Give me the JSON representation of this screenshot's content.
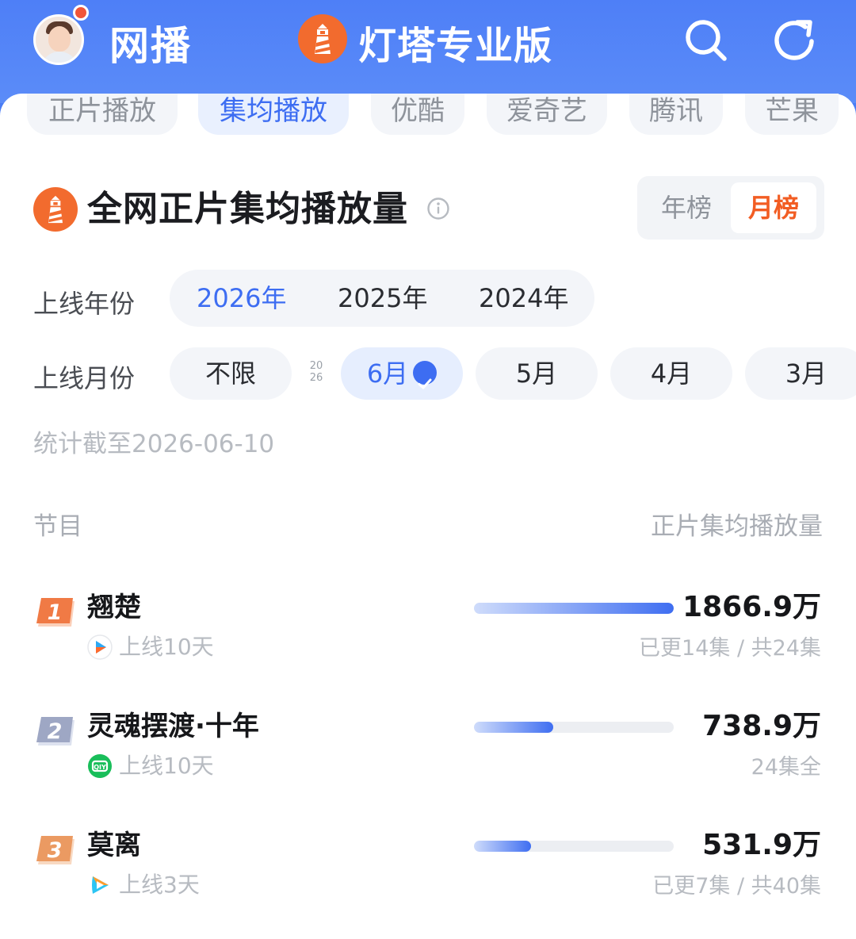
{
  "header": {
    "app_title": "网播",
    "brand_name": "灯塔专业版"
  },
  "tabs": [
    {
      "label": "正片播放",
      "active": false
    },
    {
      "label": "集均播放",
      "active": true
    },
    {
      "label": "优酷",
      "active": false
    },
    {
      "label": "爱奇艺",
      "active": false
    },
    {
      "label": "腾讯",
      "active": false
    },
    {
      "label": "芒果",
      "active": false
    }
  ],
  "section": {
    "title": "全网正片集均播放量",
    "toggle": {
      "year": "年榜",
      "month": "月榜",
      "selected": "月榜"
    }
  },
  "filters": {
    "year_label": "上线年份",
    "years": [
      "2026年",
      "2025年",
      "2024年"
    ],
    "selected_year": "2026年",
    "month_label": "上线月份",
    "months": [
      "不限",
      "6月",
      "5月",
      "4月",
      "3月"
    ],
    "selected_month": "6月",
    "year_marker": [
      "20",
      "26"
    ]
  },
  "as_of": "统计截至2026-06-10",
  "table": {
    "col_left": "节目",
    "col_right": "正片集均播放量",
    "rows": [
      {
        "rank": "1",
        "title": "翘楚",
        "platform": "youku-icon",
        "days": "上线10天",
        "plays": "1866.9万",
        "bar": 1.0,
        "episodes": "已更14集 / 共24集"
      },
      {
        "rank": "2",
        "title": "灵魂摆渡·十年",
        "platform": "iqiyi-icon",
        "days": "上线10天",
        "plays": "738.9万",
        "bar": 0.396,
        "episodes": "24集全"
      },
      {
        "rank": "3",
        "title": "莫离",
        "platform": "tencent-video-icon",
        "days": "上线3天",
        "plays": "531.9万",
        "bar": 0.285,
        "episodes": "已更7集 / 共40集"
      }
    ]
  },
  "colors": {
    "header_blue": "#4e7ff7",
    "accent_blue": "#3d6df2",
    "accent_orange": "#f25d23",
    "rank1": "#f07a45",
    "rank2": "#9ea7c4",
    "rank3": "#eb9a62"
  }
}
